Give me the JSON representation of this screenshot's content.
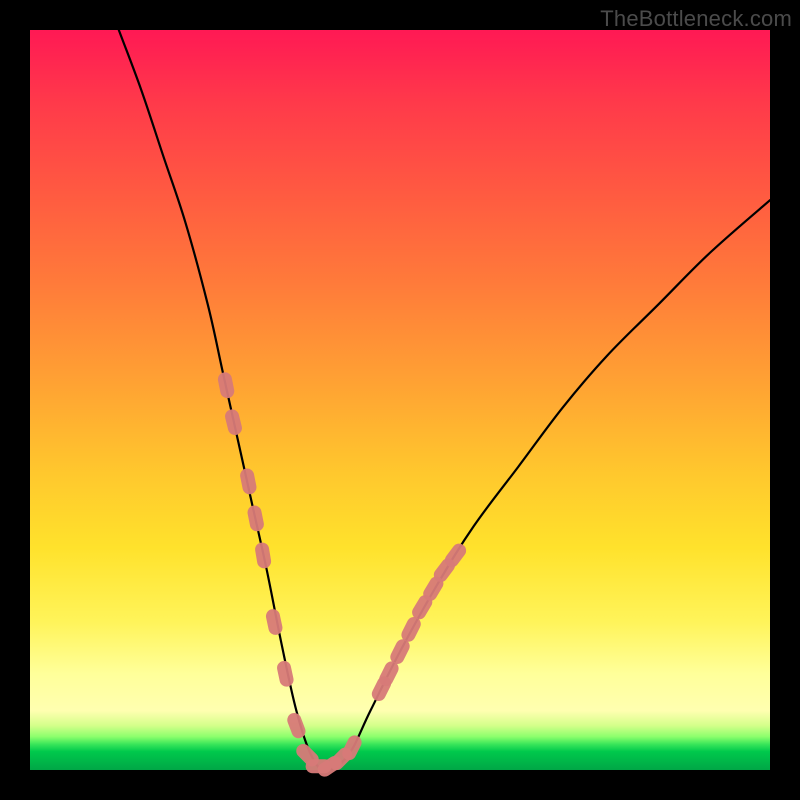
{
  "watermark": "TheBottleneck.com",
  "colors": {
    "frame": "#000000",
    "curve": "#000000",
    "markers": "#d77a78",
    "gradient_top": "#ff1954",
    "gradient_bottom": "#00a646"
  },
  "chart_data": {
    "type": "line",
    "title": "",
    "xlabel": "",
    "ylabel": "",
    "xlim": [
      0,
      100
    ],
    "ylim": [
      0,
      100
    ],
    "series": [
      {
        "name": "bottleneck-curve",
        "x": [
          12,
          15,
          18,
          21,
          24,
          26,
          28,
          30,
          32,
          34,
          36,
          38,
          40,
          43,
          46,
          50,
          55,
          60,
          66,
          72,
          78,
          85,
          92,
          100
        ],
        "y": [
          100,
          92,
          83,
          74,
          63,
          54,
          45,
          36,
          27,
          17,
          8,
          2,
          0,
          2,
          8,
          16,
          25,
          33,
          41,
          49,
          56,
          63,
          70,
          77
        ]
      }
    ],
    "markers": {
      "name": "highlighted-points",
      "points": [
        {
          "x": 26.5,
          "y": 52
        },
        {
          "x": 27.5,
          "y": 47
        },
        {
          "x": 29.5,
          "y": 39
        },
        {
          "x": 30.5,
          "y": 34
        },
        {
          "x": 31.5,
          "y": 29
        },
        {
          "x": 33.0,
          "y": 20
        },
        {
          "x": 34.5,
          "y": 13
        },
        {
          "x": 36.0,
          "y": 6
        },
        {
          "x": 37.5,
          "y": 2
        },
        {
          "x": 39.0,
          "y": 0.5
        },
        {
          "x": 40.5,
          "y": 0.5
        },
        {
          "x": 42.0,
          "y": 1.5
        },
        {
          "x": 43.5,
          "y": 3
        },
        {
          "x": 47.5,
          "y": 11
        },
        {
          "x": 48.5,
          "y": 13
        },
        {
          "x": 50.0,
          "y": 16
        },
        {
          "x": 51.5,
          "y": 19
        },
        {
          "x": 53.0,
          "y": 22
        },
        {
          "x": 54.5,
          "y": 24.5
        },
        {
          "x": 56.0,
          "y": 27
        },
        {
          "x": 57.5,
          "y": 29
        }
      ]
    }
  }
}
